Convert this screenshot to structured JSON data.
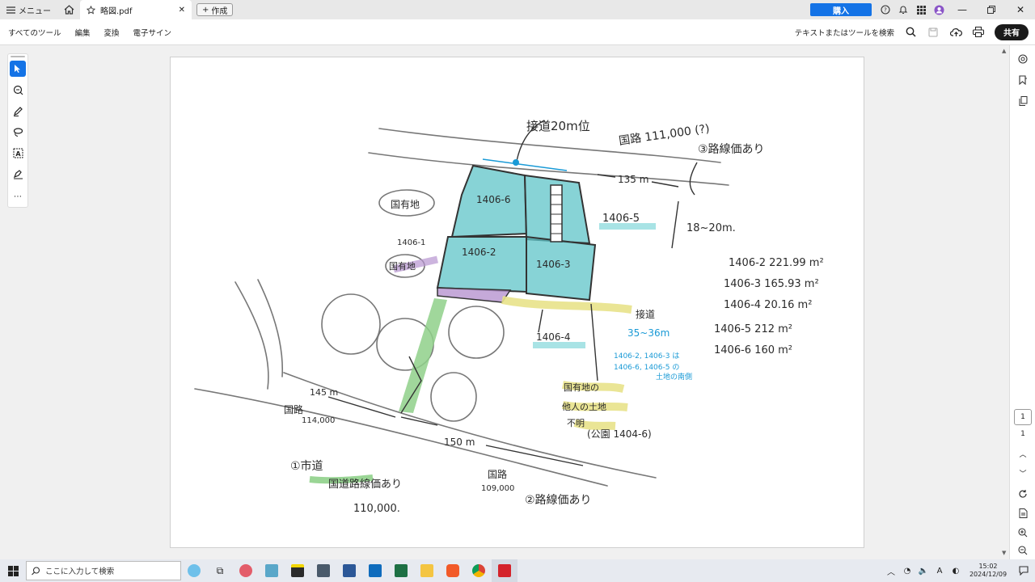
{
  "titlebar": {
    "menu_label": "メニュー",
    "tab_title": "略図.pdf",
    "new_label": "作成",
    "buy_label": "購入"
  },
  "menubar": {
    "items": [
      "すべてのツール",
      "編集",
      "変換",
      "電子サイン"
    ],
    "search_label": "テキストまたはツールを検索",
    "share_label": "共有"
  },
  "document": {
    "top_note": "接道20m位",
    "road_top": "国路 111,000 (?)",
    "road_top_note": "③路線価あり",
    "dist_135": "135 m",
    "dist_18": "18~20m.",
    "kokuyu_1": "国有地",
    "kokuyu_2": "国有地",
    "lot_1406_6": "1406-6",
    "lot_1406_5": "1406-5",
    "lot_1406_1": "1406-1",
    "lot_1406_2": "1406-2",
    "lot_1406_3": "1406-3",
    "lot_1406_4": "1406-4",
    "area_list": [
      "1406-2  221.99 m²",
      "1406-3  165.93 m²",
      "1406-4  20.16 m²",
      "1406-5  212 m²",
      "1406-6  160 m²"
    ],
    "setsudo": "接道",
    "width_35": "35~36m",
    "blue_note_1": "1406-2, 1406-3 は",
    "blue_note_2": "1406-6, 1406-5 の",
    "blue_note_3": "土地の南側",
    "kokuyu_note_1": "国有地の",
    "kokuyu_note_2": "他人の土地",
    "kokuyu_note_3": "不明",
    "kouen": "(公園 1404-6)",
    "dist_145": "145 m",
    "road_left": "国路",
    "road_left_val": "114,000",
    "dist_150": "150 m",
    "shido_1": "①市道",
    "shido_2": "国道路線価あり",
    "shido_3": "110,000.",
    "road_bottom": "国路",
    "road_bottom_val": "109,000",
    "rosenka_2": "②路線価あり"
  },
  "rightrail": {
    "page_current": "1",
    "page_total": "1"
  },
  "taskbar": {
    "search_placeholder": "ここに入力して検索",
    "time": "15:02",
    "date": "2024/12/09"
  },
  "colors": {
    "accent": "#1473e6",
    "teal": "#5fc4c8",
    "green": "#8fd08a",
    "purple": "#b794d0",
    "yellow": "#e8e28a",
    "blue_ink": "#1a9ad6"
  }
}
